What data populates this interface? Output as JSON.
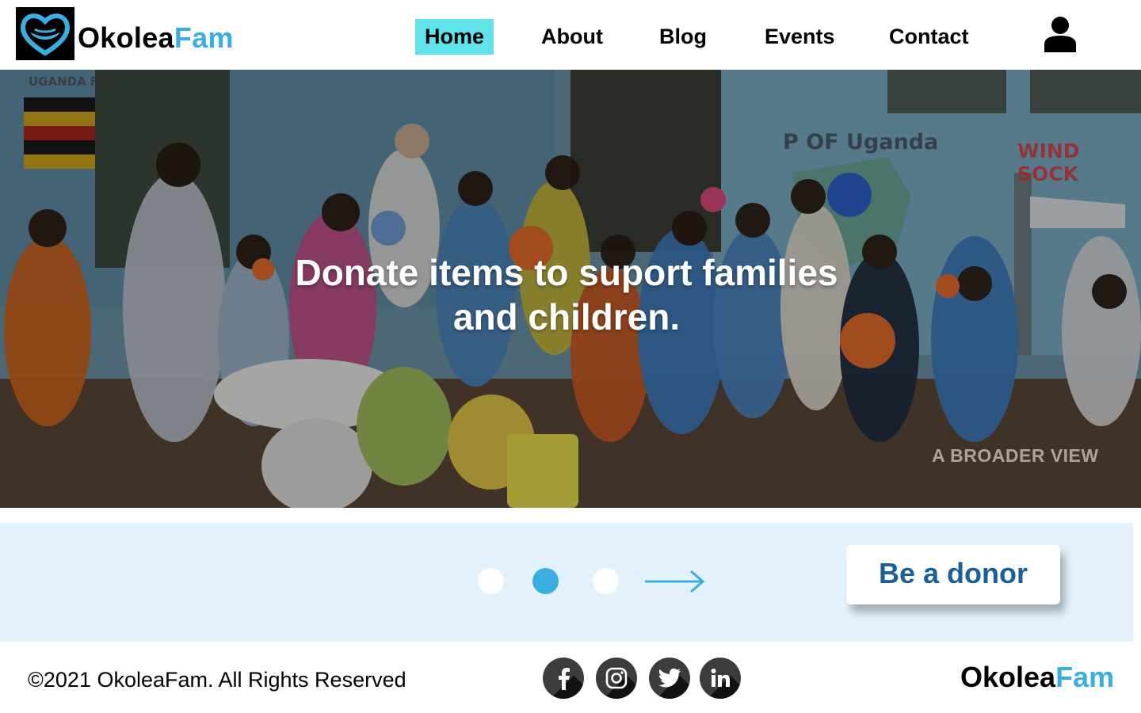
{
  "brand": {
    "part1": "Okolea",
    "part2": "Fam",
    "accent_color": "#3aaee0"
  },
  "nav": {
    "items": [
      {
        "label": "Home",
        "active": true
      },
      {
        "label": "About",
        "active": false
      },
      {
        "label": "Blog",
        "active": false
      },
      {
        "label": "Events",
        "active": false
      },
      {
        "label": "Contact",
        "active": false
      }
    ],
    "active_color": "#5fe2ea",
    "user_icon": "user-icon"
  },
  "hero": {
    "title_line1": "Donate items to suport families",
    "title_line2": "and children.",
    "watermark": "A BROADER VIEW",
    "wall_texts": [
      "UGANDA FLA",
      "P OF Uganda",
      "WIND SOCK"
    ]
  },
  "slider": {
    "dots": 3,
    "active_dot": 2,
    "next_icon": "arrow-right-icon"
  },
  "cta": {
    "label": "Be a donor",
    "color": "#1a5e9a"
  },
  "footer": {
    "copyright": "©2021 OkoleaFam. All Rights Reserved",
    "social": [
      "facebook-icon",
      "instagram-icon",
      "twitter-icon",
      "linkedin-icon"
    ],
    "brand_part1": "Okolea",
    "brand_part2": "Fam"
  }
}
